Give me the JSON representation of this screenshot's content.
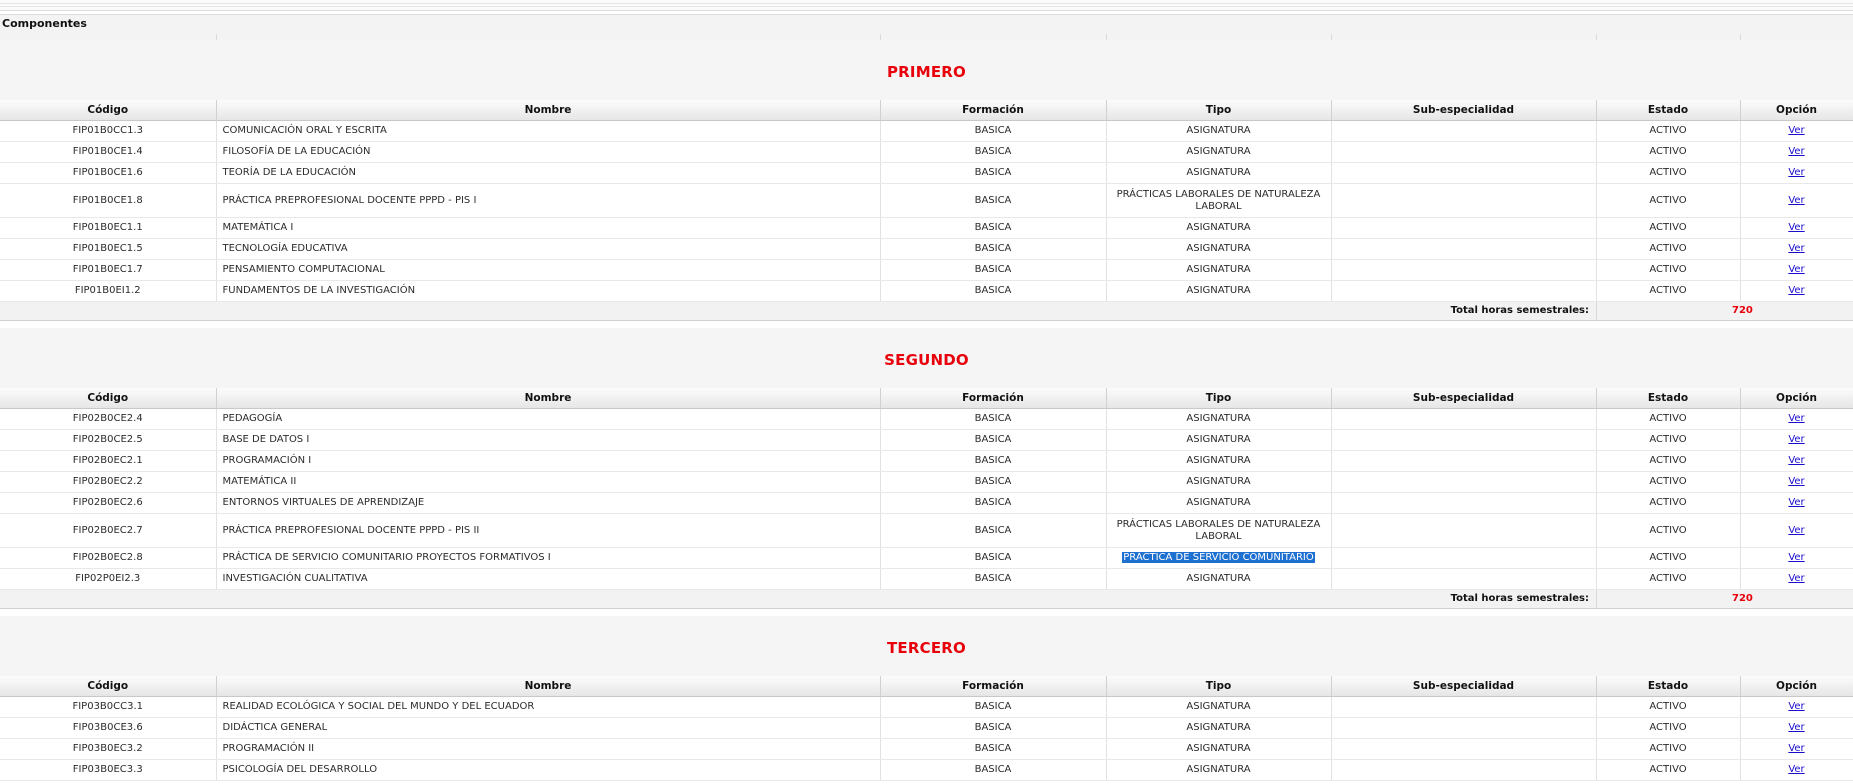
{
  "header": {
    "title": "Componentes"
  },
  "columns": [
    "Código",
    "Nombre",
    "Formación",
    "Tipo",
    "Sub-especialidad",
    "Estado",
    "Opción"
  ],
  "total_label": "Total horas semestrales:",
  "sections": [
    {
      "title": "PRIMERO",
      "total": "720",
      "rows": [
        {
          "codigo": "FIP01B0CC1.3",
          "nombre": "COMUNICACIÓN ORAL Y ESCRITA",
          "formacion": "BASICA",
          "tipo": "ASIGNATURA",
          "sub": "",
          "estado": "ACTIVO",
          "opcion": "Ver"
        },
        {
          "codigo": "FIP01B0CE1.4",
          "nombre": "FILOSOFÍA DE LA EDUCACIÓN",
          "formacion": "BASICA",
          "tipo": "ASIGNATURA",
          "sub": "",
          "estado": "ACTIVO",
          "opcion": "Ver"
        },
        {
          "codigo": "FIP01B0CE1.6",
          "nombre": "TEORÍA DE LA EDUCACIÓN",
          "formacion": "BASICA",
          "tipo": "ASIGNATURA",
          "sub": "",
          "estado": "ACTIVO",
          "opcion": "Ver"
        },
        {
          "codigo": "FIP01B0CE1.8",
          "nombre": "PRÁCTICA PREPROFESIONAL DOCENTE PPPD - PIS I",
          "formacion": "BASICA",
          "tipo": "PRÁCTICAS LABORALES DE NATURALEZA LABORAL",
          "sub": "",
          "estado": "ACTIVO",
          "opcion": "Ver"
        },
        {
          "codigo": "FIP01B0EC1.1",
          "nombre": "MATEMÁTICA I",
          "formacion": "BASICA",
          "tipo": "ASIGNATURA",
          "sub": "",
          "estado": "ACTIVO",
          "opcion": "Ver"
        },
        {
          "codigo": "FIP01B0EC1.5",
          "nombre": "TECNOLOGÍA EDUCATIVA",
          "formacion": "BASICA",
          "tipo": "ASIGNATURA",
          "sub": "",
          "estado": "ACTIVO",
          "opcion": "Ver"
        },
        {
          "codigo": "FIP01B0EC1.7",
          "nombre": "PENSAMIENTO COMPUTACIONAL",
          "formacion": "BASICA",
          "tipo": "ASIGNATURA",
          "sub": "",
          "estado": "ACTIVO",
          "opcion": "Ver"
        },
        {
          "codigo": "FIP01B0EI1.2",
          "nombre": "FUNDAMENTOS DE LA INVESTIGACIÓN",
          "formacion": "BASICA",
          "tipo": "ASIGNATURA",
          "sub": "",
          "estado": "ACTIVO",
          "opcion": "Ver"
        }
      ]
    },
    {
      "title": "SEGUNDO",
      "total": "720",
      "rows": [
        {
          "codigo": "FIP02B0CE2.4",
          "nombre": "PEDAGOGÍA",
          "formacion": "BASICA",
          "tipo": "ASIGNATURA",
          "sub": "",
          "estado": "ACTIVO",
          "opcion": "Ver"
        },
        {
          "codigo": "FIP02B0CE2.5",
          "nombre": "BASE DE DATOS I",
          "formacion": "BASICA",
          "tipo": "ASIGNATURA",
          "sub": "",
          "estado": "ACTIVO",
          "opcion": "Ver"
        },
        {
          "codigo": "FIP02B0EC2.1",
          "nombre": "PROGRAMACIÓN I",
          "formacion": "BASICA",
          "tipo": "ASIGNATURA",
          "sub": "",
          "estado": "ACTIVO",
          "opcion": "Ver"
        },
        {
          "codigo": "FIP02B0EC2.2",
          "nombre": "MATEMÁTICA II",
          "formacion": "BASICA",
          "tipo": "ASIGNATURA",
          "sub": "",
          "estado": "ACTIVO",
          "opcion": "Ver"
        },
        {
          "codigo": "FIP02B0EC2.6",
          "nombre": "ENTORNOS VIRTUALES DE APRENDIZAJE",
          "formacion": "BASICA",
          "tipo": "ASIGNATURA",
          "sub": "",
          "estado": "ACTIVO",
          "opcion": "Ver"
        },
        {
          "codigo": "FIP02B0EC2.7",
          "nombre": "PRÁCTICA PREPROFESIONAL DOCENTE PPPD - PIS II",
          "formacion": "BASICA",
          "tipo": "PRÁCTICAS LABORALES DE NATURALEZA LABORAL",
          "sub": "",
          "estado": "ACTIVO",
          "opcion": "Ver"
        },
        {
          "codigo": "FIP02B0EC2.8",
          "nombre": "PRÁCTICA DE SERVICIO COMUNITARIO PROYECTOS FORMATIVOS I",
          "formacion": "BASICA",
          "tipo": "PRÁCTICA DE SERVICIO COMUNITARIO",
          "sub": "",
          "estado": "ACTIVO",
          "opcion": "Ver",
          "selected": true
        },
        {
          "codigo": "FIP02P0EI2.3",
          "nombre": "INVESTIGACIÓN CUALITATIVA",
          "formacion": "BASICA",
          "tipo": "ASIGNATURA",
          "sub": "",
          "estado": "ACTIVO",
          "opcion": "Ver"
        }
      ]
    },
    {
      "title": "TERCERO",
      "total": "",
      "rows": [
        {
          "codigo": "FIP03B0CC3.1",
          "nombre": "REALIDAD ECOLÓGICA Y SOCIAL DEL MUNDO Y DEL ECUADOR",
          "formacion": "BASICA",
          "tipo": "ASIGNATURA",
          "sub": "",
          "estado": "ACTIVO",
          "opcion": "Ver"
        },
        {
          "codigo": "FIP03B0CE3.6",
          "nombre": "DIDÁCTICA GENERAL",
          "formacion": "BASICA",
          "tipo": "ASIGNATURA",
          "sub": "",
          "estado": "ACTIVO",
          "opcion": "Ver"
        },
        {
          "codigo": "FIP03B0EC3.2",
          "nombre": "PROGRAMACIÓN II",
          "formacion": "BASICA",
          "tipo": "ASIGNATURA",
          "sub": "",
          "estado": "ACTIVO",
          "opcion": "Ver"
        },
        {
          "codigo": "FIP03B0EC3.3",
          "nombre": "PSICOLOGÍA DEL DESARROLLO",
          "formacion": "BASICA",
          "tipo": "ASIGNATURA",
          "sub": "",
          "estado": "ACTIVO",
          "opcion": "Ver"
        }
      ]
    }
  ]
}
